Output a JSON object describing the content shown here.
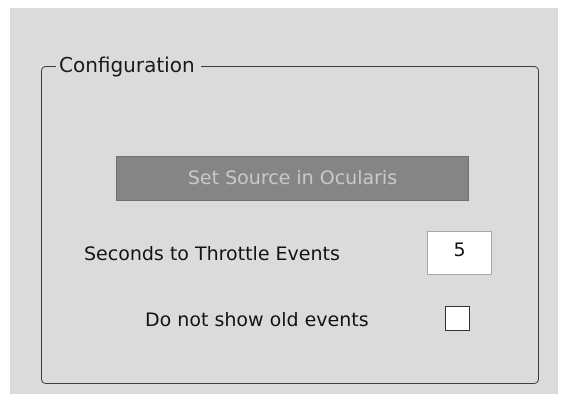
{
  "configuration": {
    "group_title": "Configuration",
    "set_source_button_label": "Set Source in Ocularis",
    "set_source_button_enabled": false,
    "throttle_label": "Seconds to Throttle Events",
    "throttle_value": "5",
    "old_events_label": "Do not show old events",
    "old_events_checked": false
  }
}
